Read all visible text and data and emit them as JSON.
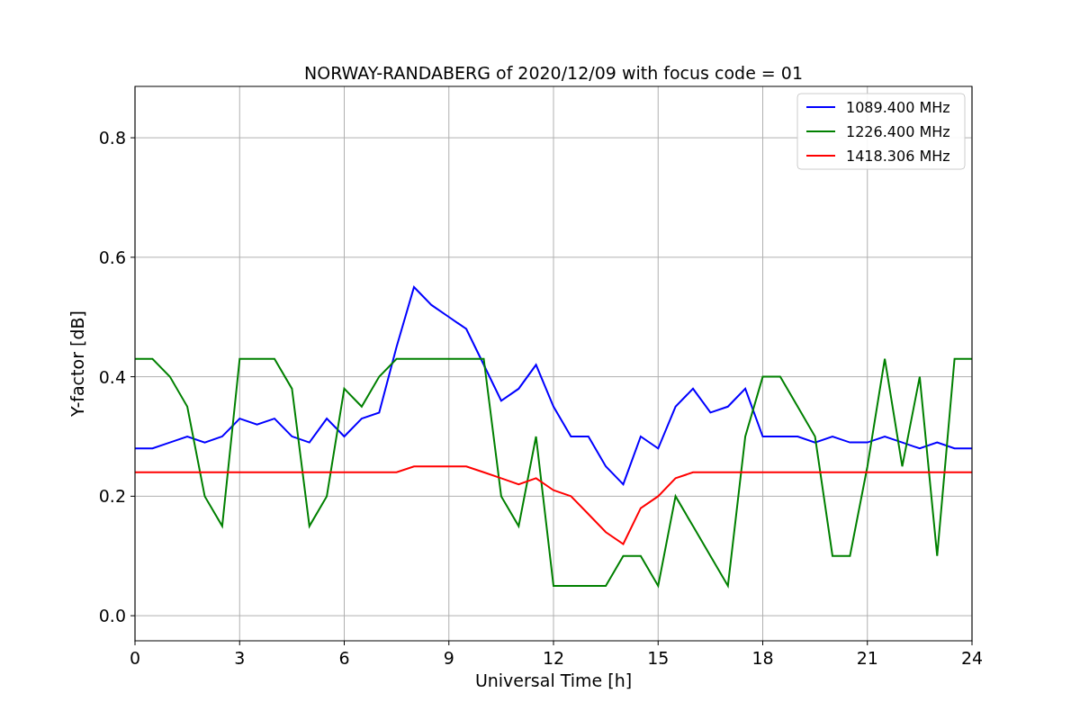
{
  "figure": {
    "chart_data": {
      "type": "line",
      "title": "NORWAY-RANDABERG of 2020/12/09 with focus code = 01",
      "xlabel": "Universal Time [h]",
      "ylabel": "Y-factor [dB]",
      "x": [
        0,
        0.5,
        1,
        1.5,
        2,
        2.5,
        3,
        3.5,
        4,
        4.5,
        5,
        5.5,
        6,
        6.5,
        7,
        7.5,
        8,
        8.5,
        9,
        9.5,
        10,
        10.5,
        11,
        11.5,
        12,
        12.5,
        13,
        13.5,
        14,
        14.5,
        15,
        15.5,
        16,
        16.5,
        17,
        17.5,
        18,
        18.5,
        19,
        19.5,
        20,
        20.5,
        21,
        21.5,
        22,
        22.5,
        23,
        23.5,
        24
      ],
      "series": [
        {
          "name": "1089.400 MHz",
          "color": "#0000ff",
          "values": [
            0.28,
            0.28,
            0.29,
            0.3,
            0.29,
            0.3,
            0.33,
            0.32,
            0.33,
            0.3,
            0.29,
            0.33,
            0.3,
            0.33,
            0.34,
            0.45,
            0.55,
            0.52,
            0.5,
            0.48,
            0.42,
            0.36,
            0.38,
            0.42,
            0.35,
            0.3,
            0.3,
            0.25,
            0.22,
            0.3,
            0.28,
            0.35,
            0.38,
            0.34,
            0.35,
            0.38,
            0.3,
            0.3,
            0.3,
            0.29,
            0.3,
            0.29,
            0.29,
            0.3,
            0.29,
            0.28,
            0.29,
            0.28,
            0.28
          ]
        },
        {
          "name": "1226.400 MHz",
          "color": "#008000",
          "values": [
            0.43,
            0.43,
            0.4,
            0.35,
            0.2,
            0.15,
            0.43,
            0.43,
            0.43,
            0.38,
            0.15,
            0.2,
            0.38,
            0.35,
            0.4,
            0.43,
            0.43,
            0.43,
            0.43,
            0.43,
            0.43,
            0.2,
            0.15,
            0.3,
            0.05,
            0.05,
            0.05,
            0.05,
            0.1,
            0.1,
            0.05,
            0.2,
            0.15,
            0.1,
            0.05,
            0.3,
            0.4,
            0.4,
            0.35,
            0.3,
            0.1,
            0.1,
            0.25,
            0.43,
            0.25,
            0.4,
            0.1,
            0.43,
            0.43
          ]
        },
        {
          "name": "1418.306 MHz",
          "color": "#ff0000",
          "values": [
            0.24,
            0.24,
            0.24,
            0.24,
            0.24,
            0.24,
            0.24,
            0.24,
            0.24,
            0.24,
            0.24,
            0.24,
            0.24,
            0.24,
            0.24,
            0.24,
            0.25,
            0.25,
            0.25,
            0.25,
            0.24,
            0.23,
            0.22,
            0.23,
            0.21,
            0.2,
            0.17,
            0.14,
            0.12,
            0.18,
            0.2,
            0.23,
            0.24,
            0.24,
            0.24,
            0.24,
            0.24,
            0.24,
            0.24,
            0.24,
            0.24,
            0.24,
            0.24,
            0.24,
            0.24,
            0.24,
            0.24,
            0.24,
            0.24
          ]
        }
      ],
      "grid": true,
      "legend": "upper right",
      "xlim": [
        0,
        24
      ],
      "ylim": [
        -0.042,
        0.886
      ],
      "xticks": [
        0,
        3,
        6,
        9,
        12,
        15,
        18,
        21,
        24
      ],
      "yticks": [
        {
          "value": 0,
          "label": "0.0"
        },
        {
          "value": 0.2,
          "label": "0.2"
        },
        {
          "value": 0.4,
          "label": "0.4"
        },
        {
          "value": 0.6,
          "label": "0.6"
        },
        {
          "value": 0.8,
          "label": "0.8"
        }
      ]
    }
  }
}
